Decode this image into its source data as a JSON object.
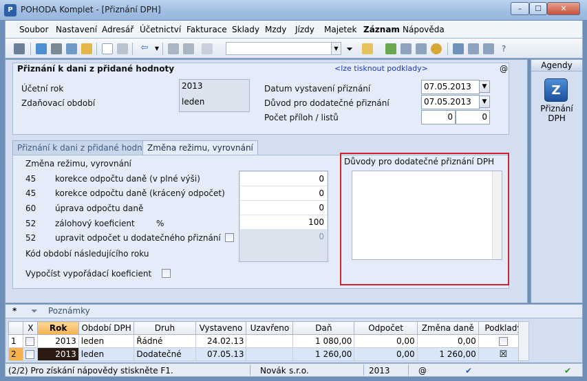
{
  "window": {
    "title": "POHODA Komplet - [Přiznání DPH]",
    "app_icon": "pohoda-app-icon",
    "minimize": "–",
    "maximize": "☐",
    "close": "✕"
  },
  "menu": [
    "Soubor",
    "Nastavení",
    "Adresář",
    "Účetnictví",
    "Fakturace",
    "Sklady",
    "Mzdy",
    "Jízdy",
    "Majetek",
    "Záznam",
    "Nápověda"
  ],
  "toolbar": {
    "icons": [
      "exit-icon",
      "save-icon",
      "print-icon",
      "print-preview-icon",
      "export-icon",
      "new-icon",
      "delete-icon",
      "back-icon",
      "dropdown-icon",
      "record-icon",
      "record2-icon",
      "copy-icon",
      "filter-icon",
      "folder-icon",
      "link-icon",
      "calculator-icon",
      "calendar-icon",
      "coins-icon",
      "mail-icon",
      "list-icon",
      "help-icon"
    ],
    "combo_value": ""
  },
  "header": {
    "title": "Přiznání k dani z přidané hodnoty",
    "print_link": "<lze tisknout podklady>",
    "at_symbol": "@",
    "ucetni_rok_label": "Účetní rok",
    "ucetni_rok_value": "2013",
    "zdanovaci_obdobi_label": "Zdaňovací období",
    "zdanovaci_obdobi_value": "leden",
    "datum_vystaveni_label": "Datum vystavení přiznání",
    "datum_vystaveni_value": "07.05.2013",
    "duvod_label": "Důvod pro dodatečné přiznání",
    "duvod_value": "07.05.2013",
    "pocet_priloh_label": "Počet příloh / listů",
    "pocet_priloh_value": "0",
    "pocet_listu_value": "0"
  },
  "tabs": [
    {
      "label": "Přiznání k dani z přidané hodnoty"
    },
    {
      "label": "Změna režimu, vyrovnání"
    }
  ],
  "zmena": {
    "group_title": "Změna režimu, vyrovnání",
    "rows": [
      {
        "code": "45",
        "label": "korekce odpočtu daně (v plné výši)",
        "unit": "",
        "value": "0"
      },
      {
        "code": "45",
        "label": "korekce odpočtu daně (krácený odpočet)",
        "unit": "",
        "value": "0"
      },
      {
        "code": "60",
        "label": "úprava odpočtu daně",
        "unit": "",
        "value": "0"
      },
      {
        "code": "52",
        "label": "zálohový koeficient",
        "unit": "%",
        "value": "100"
      },
      {
        "code": "52",
        "label": "upravit odpočet u dodatečného přiznání",
        "unit": "",
        "value": "0"
      }
    ],
    "kod_obdobi_label": "Kód období následujícího roku",
    "vypocist_label": "Vypočíst vypořádací koeficient"
  },
  "duvody": {
    "title": "Důvody pro dodatečné přiznání DPH",
    "text": ""
  },
  "agenda": {
    "header": "Agendy",
    "icon_letter": "Z",
    "label": "Přiznání DPH"
  },
  "grid_tabs": {
    "star": "*",
    "notes": "Poznámky"
  },
  "grid": {
    "columns": [
      "",
      "X",
      "Rok",
      "Období DPH",
      "Druh",
      "Vystaveno",
      "Uzavřeno",
      "Daň",
      "Odpočet",
      "Změna daně",
      "Podklady"
    ],
    "rows": [
      {
        "n": "1",
        "x": "",
        "rok": "2013",
        "obdobi": "leden",
        "druh": "Řádné",
        "vystaveno": "24.02.13",
        "uzavreno": "",
        "dan": "1 080,00",
        "odpocet": "0,00",
        "zmena": "0,00",
        "podklady": ""
      },
      {
        "n": "2",
        "x": "",
        "rok": "2013",
        "obdobi": "leden",
        "druh": "Dodatečné",
        "vystaveno": "07.05.13",
        "uzavreno": "",
        "dan": "1 260,00",
        "odpocet": "0,00",
        "zmena": "1 260,00",
        "podklady": "☒"
      }
    ]
  },
  "status": {
    "help": "(2/2) Pro získání nápovědy stiskněte F1.",
    "user": "Novák",
    "company": "s.r.o.",
    "year": "2013",
    "at": "@"
  }
}
